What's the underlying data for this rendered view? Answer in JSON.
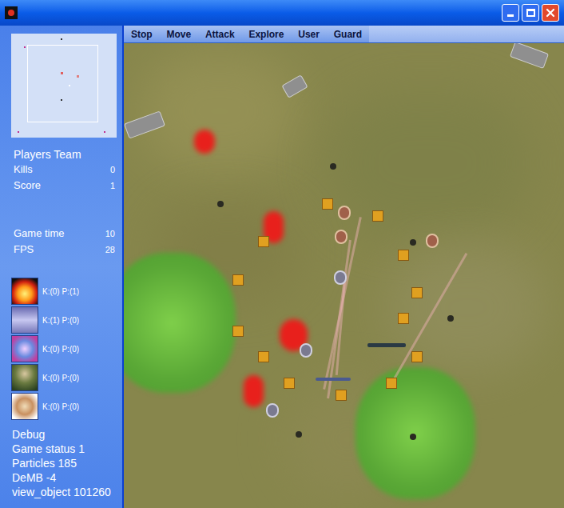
{
  "toolbar": [
    "Stop",
    "Move",
    "Attack",
    "Explore",
    "User",
    "Guard"
  ],
  "panel": {
    "team": "Players Team",
    "stats": [
      {
        "label": "Kills",
        "value": "0"
      },
      {
        "label": "Score",
        "value": "1"
      }
    ],
    "timing": [
      {
        "label": "Game time",
        "value": "10"
      },
      {
        "label": "FPS",
        "value": "28"
      }
    ],
    "units": [
      {
        "text": "K:(0) P:(1)"
      },
      {
        "text": "K:(1) P:(0)"
      },
      {
        "text": "K:(0) P:(0)"
      },
      {
        "text": "K:(0) P:(0)"
      },
      {
        "text": "K:(0) P:(0)"
      }
    ],
    "debug": [
      "Debug",
      "Game status 1",
      "Particles 185",
      "DeMB -4",
      "view_object 101260"
    ]
  }
}
